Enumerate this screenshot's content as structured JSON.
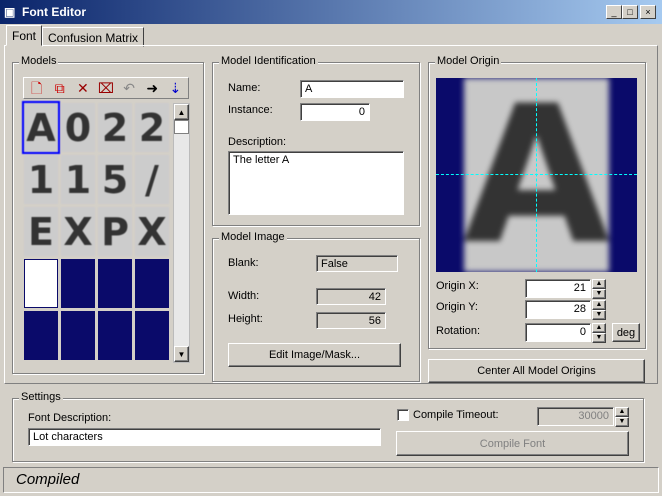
{
  "window": {
    "title": "Font Editor",
    "minimize": "_",
    "maximize": "□",
    "close": "×"
  },
  "tabs": [
    {
      "label": "Font",
      "active": true
    },
    {
      "label": "Confusion Matrix",
      "active": false
    }
  ],
  "models": {
    "legend": "Models",
    "toolbar": [
      {
        "icon": "new-model-icon",
        "glyph": "🗋"
      },
      {
        "icon": "copy-model-icon",
        "glyph": "⧉"
      },
      {
        "icon": "delete-icon",
        "glyph": "✕"
      },
      {
        "icon": "delete-all-icon",
        "glyph": "⌧"
      },
      {
        "icon": "arrow-left-icon",
        "glyph": "↶"
      },
      {
        "icon": "arrow-right-icon",
        "glyph": "➜"
      },
      {
        "icon": "sort-icon",
        "glyph": "⇣"
      }
    ],
    "tiles": [
      "A",
      "0",
      "2",
      "2",
      "1",
      "1",
      "5",
      "/",
      "E",
      "X",
      "P",
      "X",
      "",
      "",
      "",
      "",
      "",
      "",
      "",
      ""
    ]
  },
  "identification": {
    "legend": "Model Identification",
    "name_label": "Name:",
    "name_value": "A",
    "instance_label": "Instance:",
    "instance_value": "0",
    "description_label": "Description:",
    "description_value": "The letter A"
  },
  "image": {
    "legend": "Model Image",
    "blank_label": "Blank:",
    "blank_value": "False",
    "width_label": "Width:",
    "width_value": "42",
    "height_label": "Height:",
    "height_value": "56",
    "edit_button": "Edit Image/Mask..."
  },
  "origin": {
    "legend": "Model Origin",
    "preview_letter": "A",
    "x_label": "Origin X:",
    "x_value": "21",
    "y_label": "Origin Y:",
    "y_value": "28",
    "rotation_label": "Rotation:",
    "rotation_value": "0",
    "unit_button": "deg",
    "center_button": "Center All Model Origins",
    "crosshair_color": "#00ffff"
  },
  "settings": {
    "legend": "Settings",
    "font_description_label": "Font Description:",
    "font_description_value": "Lot characters",
    "compile_timeout_label": "Compile Timeout:",
    "compile_timeout_checked": false,
    "compile_timeout_value": "30000",
    "compile_button": "Compile Font"
  },
  "status": {
    "text": "Compiled"
  }
}
